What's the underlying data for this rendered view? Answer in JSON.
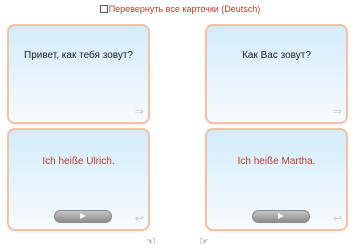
{
  "toggle": {
    "label": "Перевернуть все карточки (Deutsch)",
    "checked": false
  },
  "cards": [
    {
      "question": "Привет, как тебя зовут?",
      "answer": "Ich heiße Ulrich."
    },
    {
      "question": "Как Вас зовут?",
      "answer": "Ich heiße Martha."
    }
  ],
  "icons": {
    "flip": "flip-arrow-icon",
    "back": "return-arrow-icon",
    "play": "play-icon",
    "prev": "hand-left-icon",
    "next": "hand-right-icon"
  },
  "colors": {
    "answer_text": "#c0392b",
    "card_border": "#f1c2a4",
    "card_top": "#d3ecfb"
  }
}
